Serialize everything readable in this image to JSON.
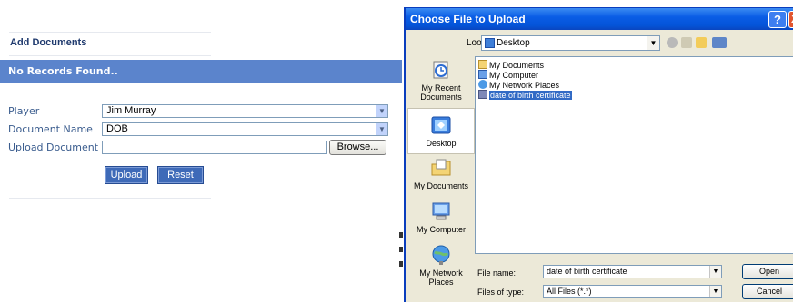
{
  "page": {
    "title": "Add Documents",
    "banner": "No Records Found..",
    "form": {
      "player_label": "Player",
      "player_value": "Jim Murray",
      "docname_label": "Document Name",
      "docname_value": "DOB",
      "upload_label": "Upload Document",
      "upload_value": "",
      "browse_label": "Browse...",
      "upload_button": "Upload",
      "reset_button": "Reset"
    }
  },
  "dialog": {
    "title": "Choose File to Upload",
    "help_label": "?",
    "close_label": "X",
    "look_in_label": "Look in:",
    "look_in_value": "Desktop",
    "places": [
      {
        "label": "My Recent Documents",
        "icon": "recent-documents-icon"
      },
      {
        "label": "Desktop",
        "icon": "desktop-icon"
      },
      {
        "label": "My Documents",
        "icon": "my-documents-icon"
      },
      {
        "label": "My Computer",
        "icon": "my-computer-icon"
      },
      {
        "label": "My Network Places",
        "icon": "network-places-icon"
      }
    ],
    "files": [
      {
        "name": "My Documents",
        "icon": "folder-icon",
        "selected": false
      },
      {
        "name": "My Computer",
        "icon": "computer-icon",
        "selected": false
      },
      {
        "name": "My Network Places",
        "icon": "network-icon",
        "selected": false
      },
      {
        "name": "date of birth certificate",
        "icon": "document-icon",
        "selected": true
      }
    ],
    "file_name_label": "File name:",
    "file_name_value": "date of birth certificate",
    "file_type_label": "Files of type:",
    "file_type_value": "All Files (*.*)",
    "open_button": "Open",
    "cancel_button": "Cancel"
  },
  "colors": {
    "banner": "#5b84cc",
    "label": "#3a5c8e",
    "titlebar": "#0a5de6",
    "selection": "#316ac5"
  }
}
